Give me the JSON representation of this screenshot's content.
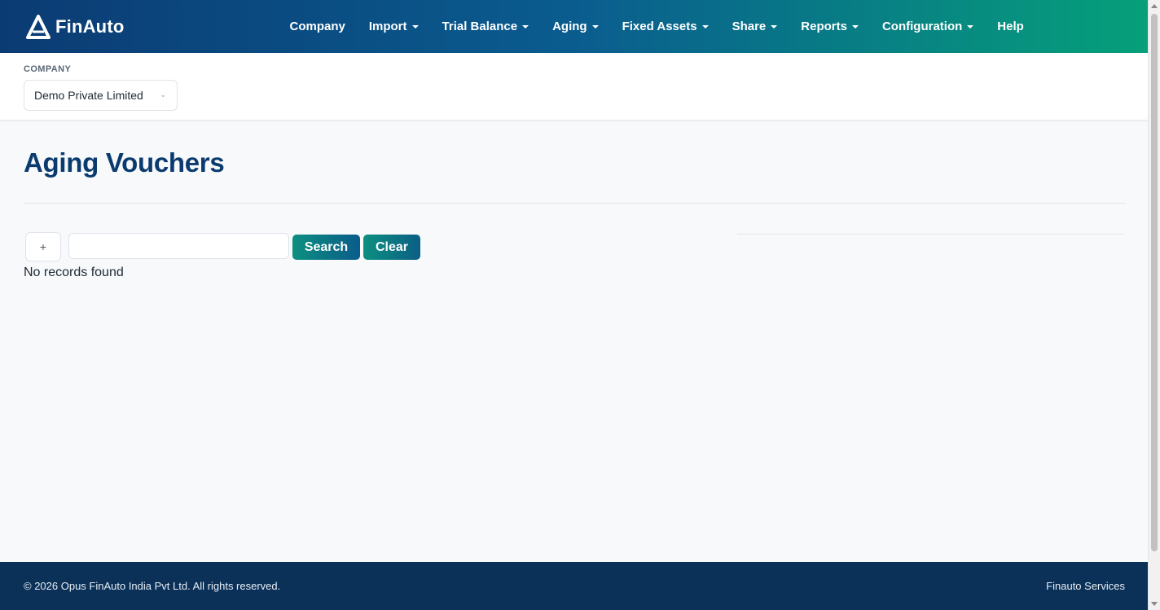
{
  "brand": {
    "name": "FinAuto"
  },
  "nav": {
    "items": [
      {
        "label": "Company",
        "dropdown": false
      },
      {
        "label": "Import",
        "dropdown": true
      },
      {
        "label": "Trial Balance",
        "dropdown": true
      },
      {
        "label": "Aging",
        "dropdown": true
      },
      {
        "label": "Fixed Assets",
        "dropdown": true
      },
      {
        "label": "Share",
        "dropdown": true
      },
      {
        "label": "Reports",
        "dropdown": true
      },
      {
        "label": "Configuration",
        "dropdown": true
      },
      {
        "label": "Help",
        "dropdown": false
      }
    ]
  },
  "company": {
    "label": "COMPANY",
    "selected": "Demo Private Limited"
  },
  "page": {
    "title": "Aging Vouchers"
  },
  "toolbar": {
    "add_label": "+",
    "search_value": "",
    "search_placeholder": "",
    "search_label": "Search",
    "clear_label": "Clear"
  },
  "results": {
    "empty_text": "No records found"
  },
  "footer": {
    "copyright": "© 2026 Opus FinAuto India Pvt Ltd. All rights reserved.",
    "right_text": "Finauto Services"
  },
  "colors": {
    "nav_gradient_start": "#0b3b73",
    "nav_gradient_end": "#06a07a",
    "title": "#0b3b6e",
    "button_start": "#0d8f80",
    "button_end": "#0a5c8a",
    "footer_bg": "#0b3158"
  }
}
